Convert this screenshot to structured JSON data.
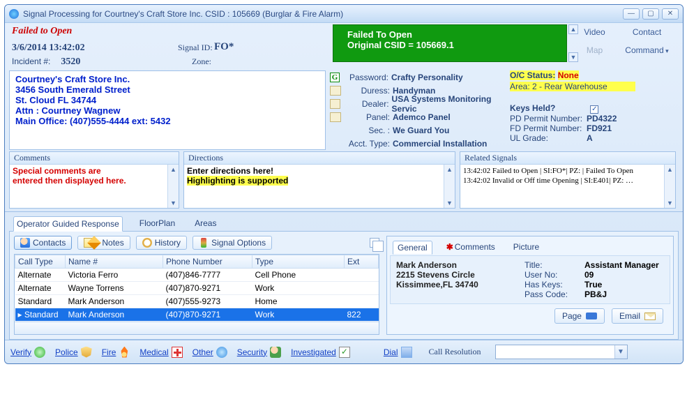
{
  "titlebar": {
    "title": "Signal Processing for Courtney's Craft Store Inc.   CSID : 105669 (Burglar & Fire Alarm)"
  },
  "header": {
    "fail": "Failed to Open",
    "datetime": "3/6/2014 13:42:02",
    "incident_label": "Incident #:",
    "incident": "3520",
    "signalid_label": "Signal ID:",
    "signalid": "FO*",
    "zone_label": "Zone:",
    "green_line1": "Failed To Open",
    "green_line2": "Original CSID = 105669.1",
    "links": {
      "video": "Video",
      "contact": "Contact",
      "map": "Map",
      "command": "Command"
    }
  },
  "address": {
    "l1": "Courtney's Craft Store Inc.",
    "l2": "3456 South Emerald Street",
    "l3": "St. Cloud  FL 34744",
    "l4": "Attn : Courtney Wagnew",
    "l5": "Main Office: (407)555-4444 ext: 5432"
  },
  "info": {
    "password_l": "Password:",
    "password": "Crafty Personality",
    "duress_l": "Duress:",
    "duress": "Handyman",
    "dealer_l": "Dealer:",
    "dealer": "USA Systems Monitoring Servic",
    "panel_l": "Panel:",
    "panel": "Ademco Panel",
    "sec_l": "Sec. :",
    "sec": "We Guard You",
    "accttype_l": "Acct. Type:",
    "accttype": "Commercial Installation"
  },
  "status": {
    "oc_label": "O/C Status:",
    "oc_val": "None",
    "area": "Area: 2 - Rear Warehouse",
    "keys": "Keys Held?",
    "pd_l": "PD Permit Number:",
    "pd": "PD4322",
    "fd_l": "FD Permit Number:",
    "fd": "FD921",
    "ul_l": "UL Grade:",
    "ul": "A"
  },
  "comments": {
    "h": "Comments",
    "l1": "Special comments are",
    "l2": "entered then displayed here."
  },
  "directions": {
    "h": "Directions",
    "l1": "Enter directions here!",
    "l2": "Highlighting is supported"
  },
  "related": {
    "h": "Related Signals",
    "rows": [
      "13:42:02  Failed to Open | SI:FO*| PZ:  |   Failed To Open",
      "13:42:02  Invalid or Off time Opening | SI:E401| PZ:  …"
    ]
  },
  "tabs": {
    "ogr": "Operator Guided Response",
    "floor": "FloorPlan",
    "areas": "Areas"
  },
  "toolbar": {
    "contacts": "Contacts",
    "notes": "Notes",
    "history": "History",
    "sigopt": "Signal Options"
  },
  "grid": {
    "cols": {
      "calltype": "Call Type",
      "namenum": "Name #",
      "phone": "Phone Number",
      "type": "Type",
      "ext": "Ext"
    },
    "rows": [
      {
        "calltype": "Alternate",
        "name": "Victoria Ferro",
        "phone": "(407)846-7777",
        "type": "Cell Phone",
        "ext": ""
      },
      {
        "calltype": "Alternate",
        "name": "Wayne Torrens",
        "phone": "(407)870-9271",
        "type": "Work",
        "ext": ""
      },
      {
        "calltype": "Standard",
        "name": "Mark Anderson",
        "phone": "(407)555-9273",
        "type": "Home",
        "ext": ""
      },
      {
        "calltype": "Standard",
        "name": "Mark Anderson",
        "phone": "(407)870-9271",
        "type": "Work",
        "ext": "822"
      }
    ]
  },
  "subtabs": {
    "general": "General",
    "comments": "Comments",
    "picture": "Picture"
  },
  "detail": {
    "name": "Mark Anderson",
    "addr1": "2215 Stevens Circle",
    "addr2": "Kissimmee,FL 34740",
    "title_l": "Title:",
    "title": "Assistant Manager",
    "userno_l": "User No:",
    "userno": "09",
    "haskeys_l": "Has Keys:",
    "haskeys": "True",
    "pass_l": "Pass Code:",
    "pass": "PB&J",
    "page_btn": "Page",
    "email_btn": "Email"
  },
  "footer": {
    "verify": "Verify",
    "police": "Police",
    "fire": "Fire",
    "medical": "Medical",
    "other": "Other",
    "security": "Security",
    "investigated": "Investigated",
    "dial": "Dial",
    "callres": "Call Resolution"
  }
}
